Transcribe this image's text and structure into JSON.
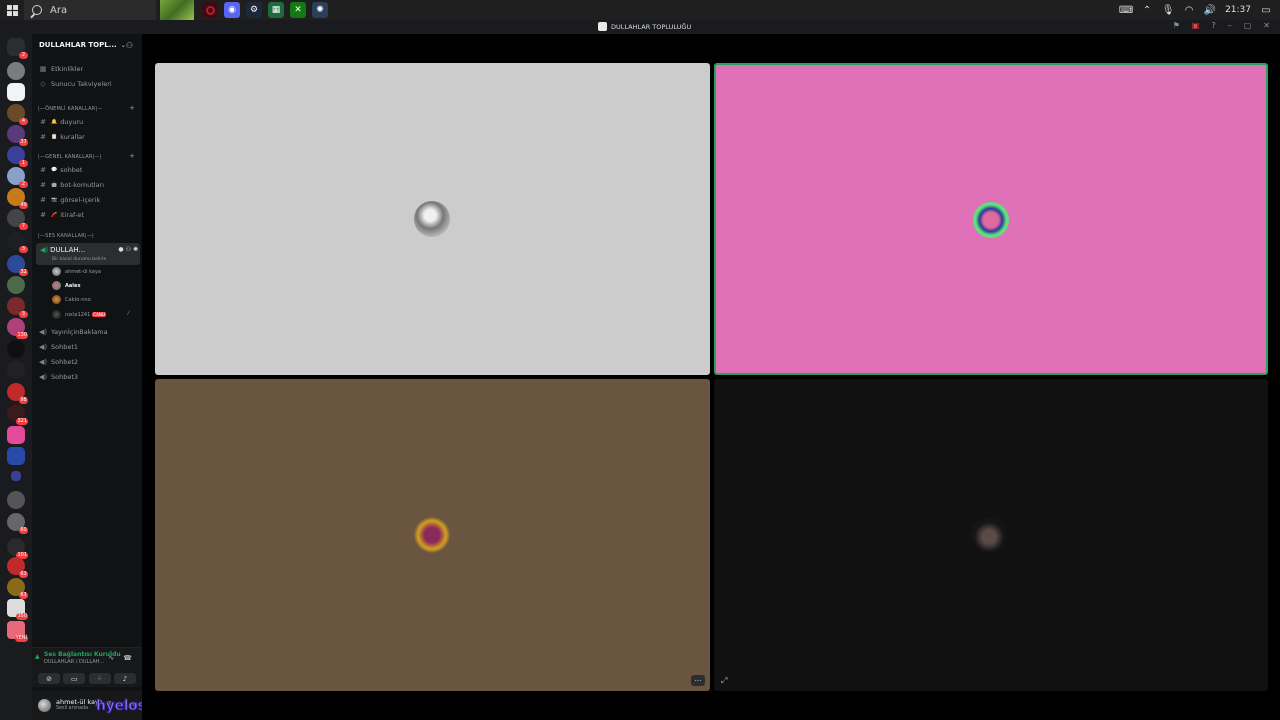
{
  "taskbar": {
    "search_placeholder": "Ara",
    "clock": "21:37"
  },
  "window": {
    "title": "DULLAHLAR TOPLULUĞU",
    "controls": [
      "–",
      "▢",
      "✕"
    ]
  },
  "server": {
    "name": "DULLAHLAR TOPL...",
    "top_links": [
      {
        "icon": "calendar-icon",
        "label": "Etkinlikler"
      },
      {
        "icon": "boost-icon",
        "label": "Sunucu Takviyeleri"
      }
    ],
    "categories": [
      {
        "label": "|—ÖNEMLİ KANALLAR|—"
      },
      {
        "label": "|—GENEL KANALLAR|—|"
      },
      {
        "label": "|—SES KANALLAR|—|"
      }
    ],
    "channels": [
      {
        "label": "duyuru",
        "emoji": "🔔"
      },
      {
        "label": "kurallar",
        "emoji": "📋"
      },
      {
        "label": "sohbet",
        "emoji": "💬"
      },
      {
        "label": "bot-komutları",
        "emoji": "🤖"
      },
      {
        "label": "görsel-içerik",
        "emoji": "📷"
      },
      {
        "label": "itiraf-et",
        "emoji": "🧨"
      }
    ],
    "active_voice": {
      "name": "DULLAH...",
      "status": "Bir kanal durumu belirle"
    },
    "voice_users": [
      {
        "name": "ahmet-ül kaya",
        "bold": false
      },
      {
        "name": "Aalex",
        "bold": true
      },
      {
        "name": "Cakto-nno",
        "bold": false
      },
      {
        "name": "rox\\e1241",
        "bold": false,
        "badge": "CANLI"
      }
    ],
    "voice_channels": [
      "YayınİçinBaklama",
      "Sohbet1",
      "Sohbet2",
      "Sohbet3"
    ]
  },
  "voice_panel": {
    "title": "Ses Bağlantısı Kuruldu",
    "subtitle": "DULLAHLAR / DULLAH..."
  },
  "user": {
    "name": "ahmet-ül kaya",
    "subtitle": "Sesli arsnada"
  },
  "watermark": "hyelose",
  "tiles": [
    {
      "bg": "#cccccc",
      "avatar": "grayscale-avatar"
    },
    {
      "bg": "#e070b8",
      "avatar": "green-ring-avatar"
    },
    {
      "bg": "#6a5640",
      "avatar": "gold-ring-avatar"
    },
    {
      "bg": "#111111",
      "avatar": "dark-avatar"
    }
  ],
  "tile_more_label": "···"
}
